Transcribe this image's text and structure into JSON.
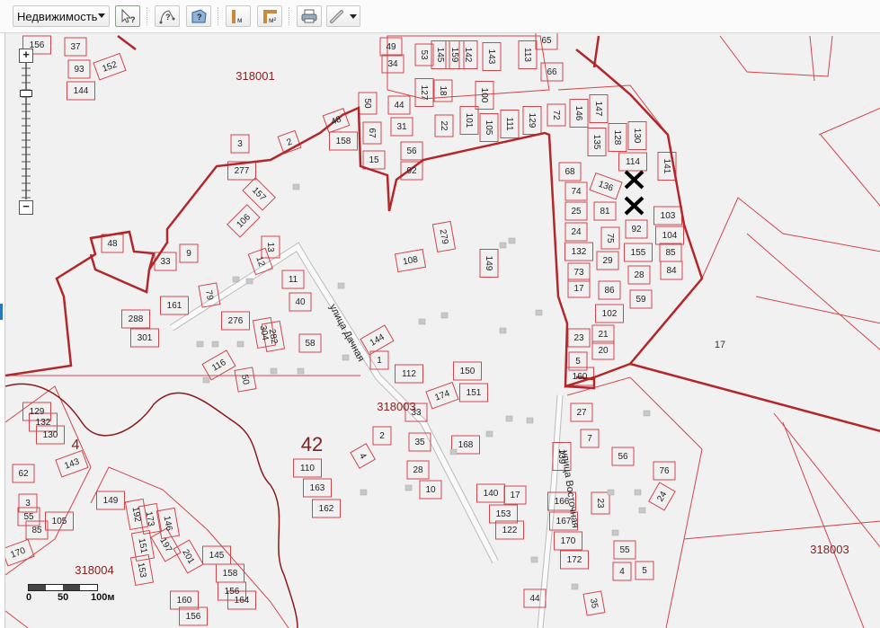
{
  "toolbar": {
    "layer_select": "Недвижимость",
    "buttons": [
      {
        "name": "identify-tool",
        "icon": "cursor-question-icon"
      },
      {
        "name": "identify-line-tool",
        "icon": "line-question-icon"
      },
      {
        "name": "identify-area-tool",
        "icon": "polygon-question-icon"
      },
      {
        "name": "measure-length-tool",
        "icon": "ruler-m-icon"
      },
      {
        "name": "measure-area-tool",
        "icon": "ruler-m2-icon"
      },
      {
        "name": "print-button",
        "icon": "printer-icon"
      },
      {
        "name": "link-button",
        "icon": "chain-link-icon"
      }
    ],
    "unit_m": "м",
    "unit_m2": "м²"
  },
  "zoom": {
    "plus": "+",
    "minus": "−"
  },
  "scale": {
    "labels": [
      "0",
      "50",
      "100м"
    ]
  },
  "map": {
    "quarters": [
      "318001",
      "318003",
      "318003",
      "318004"
    ],
    "district": "42",
    "streets": [
      "улица Дачная",
      "улица Восточная"
    ],
    "region_labels": [
      "17",
      "4"
    ],
    "parcels": [
      "156",
      "37",
      "93",
      "152",
      "144",
      "49",
      "34",
      "53",
      "145",
      "159",
      "142",
      "143",
      "113",
      "65",
      "66",
      "72",
      "146",
      "147",
      "135",
      "128",
      "130",
      "50",
      "44",
      "31",
      "127",
      "18",
      "22",
      "100",
      "101",
      "105",
      "111",
      "129",
      "48",
      "3",
      "2",
      "158",
      "67",
      "15",
      "56",
      "92",
      "114",
      "141",
      "68",
      "74",
      "136",
      "25",
      "81",
      "103",
      "24",
      "75",
      "92",
      "104",
      "132",
      "155",
      "85",
      "73",
      "29",
      "28",
      "84",
      "17",
      "86",
      "59",
      "102",
      "23",
      "21",
      "20",
      "5",
      "160",
      "277",
      "157",
      "106",
      "13",
      "12",
      "48",
      "33",
      "9",
      "108",
      "279",
      "149",
      "161",
      "79",
      "288",
      "301",
      "11",
      "40",
      "276",
      "304",
      "282",
      "58",
      "116",
      "50",
      "144",
      "1",
      "112",
      "150",
      "151",
      "174",
      "33",
      "2",
      "35",
      "4",
      "168",
      "110",
      "163",
      "162",
      "28",
      "10",
      "140",
      "17",
      "153",
      "122",
      "27",
      "7",
      "139",
      "56",
      "76",
      "24",
      "166",
      "167",
      "23",
      "170",
      "172",
      "55",
      "4",
      "5",
      "44",
      "35",
      "129",
      "132",
      "130",
      "143",
      "62",
      "3",
      "55",
      "85",
      "105",
      "149",
      "192",
      "173",
      "146",
      "151",
      "197",
      "153",
      "201",
      "145",
      "158",
      "156",
      "160",
      "156",
      "164",
      "170"
    ],
    "colors": {
      "boundary": "#b3262a",
      "parcel": "#d2454a",
      "background": "#f1f1f1",
      "marker": "#000000"
    },
    "markers": [
      "cross-marker",
      "cross-marker"
    ]
  }
}
